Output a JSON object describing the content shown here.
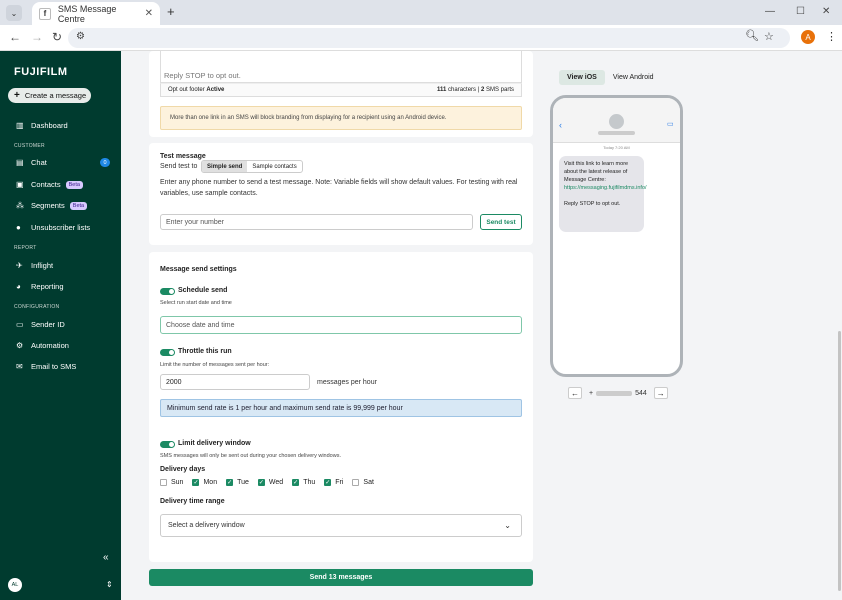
{
  "browser": {
    "tab_title": "SMS Message Centre",
    "tab_favicon": "f",
    "new_tab": "+",
    "profile_initial": "A"
  },
  "sidebar": {
    "logo": "FUJIFILM",
    "create_button": "Create a message",
    "dashboard": "Dashboard",
    "section_customer": "CUSTOMER",
    "chat": "Chat",
    "chat_count": "0",
    "contacts": "Contacts",
    "contacts_badge": "Beta",
    "segments": "Segments",
    "segments_badge": "Beta",
    "unsubscriber_lists": "Unsubscriber lists",
    "section_report": "REPORT",
    "inflight": "Inflight",
    "reporting": "Reporting",
    "section_configuration": "CONFIGURATION",
    "sender_id": "Sender ID",
    "automation": "Automation",
    "email_to_sms": "Email to SMS",
    "collapse": "«",
    "user_initials": "AL"
  },
  "compose": {
    "body_tail": "Reply STOP to opt out.",
    "footer_label": "Opt out footer",
    "footer_status": "Active",
    "char_count": "111",
    "char_label": "characters |",
    "parts_count": "2",
    "parts_label": "SMS parts",
    "warning": "More than one link in an SMS will block branding from displaying for a recipient using an Android device."
  },
  "test_message": {
    "heading": "Test message",
    "send_to_label": "Send test to",
    "options": [
      "Simple send",
      "Sample contacts"
    ],
    "description": "Enter any phone number to send a test message. Note: Variable fields will show default values. For testing with real variables, use sample contacts.",
    "placeholder": "Enter your number",
    "send_button": "Send test"
  },
  "send_settings": {
    "heading": "Message send settings",
    "schedule_label": "Schedule send",
    "schedule_sub": "Select run start date and time",
    "date_placeholder": "Choose date and time",
    "throttle_label": "Throttle this run",
    "throttle_sub": "Limit the number of messages sent per hour:",
    "throttle_value": "2000",
    "throttle_unit": "messages per hour",
    "rate_info": "Minimum send rate is 1 per hour and maximum send rate is 99,999 per hour",
    "delivery_label": "Limit delivery window",
    "delivery_sub": "SMS messages will only be sent out during your chosen delivery windows.",
    "days_heading": "Delivery days",
    "days": [
      {
        "name": "Sun",
        "checked": false
      },
      {
        "name": "Mon",
        "checked": true
      },
      {
        "name": "Tue",
        "checked": true
      },
      {
        "name": "Wed",
        "checked": true
      },
      {
        "name": "Thu",
        "checked": true
      },
      {
        "name": "Fri",
        "checked": true
      },
      {
        "name": "Sat",
        "checked": false
      }
    ],
    "time_range_heading": "Delivery time range",
    "time_range_placeholder": "Select a delivery window",
    "send_button": "Send 13 messages"
  },
  "preview": {
    "tabs": [
      "View iOS",
      "View Android"
    ],
    "time": "Today 7:20 AM",
    "msg_line1": "Visit this link to learn more about the latest release of Message Centre:",
    "msg_link": "https://messaging.fujifilmdms.info/",
    "msg_line2": "Reply STOP to opt out.",
    "number_prefix": "+",
    "number_suffix": "544"
  }
}
